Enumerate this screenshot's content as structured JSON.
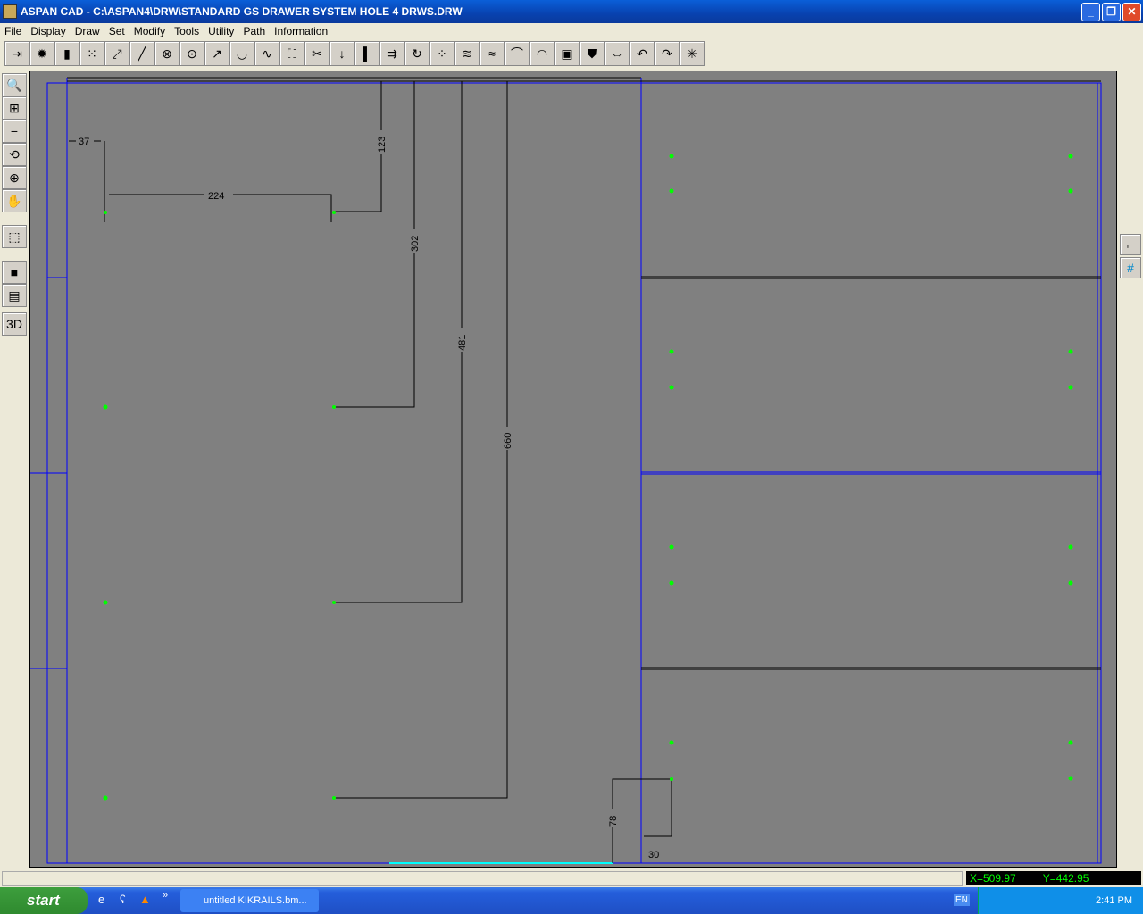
{
  "window": {
    "title": "ASPAN CAD - C:\\ASPAN4\\DRW\\STANDARD GS DRAWER SYSTEM HOLE 4 DRWS.DRW"
  },
  "menu": [
    "File",
    "Display",
    "Draw",
    "Set",
    "Modify",
    "Tools",
    "Utility",
    "Path",
    "Information"
  ],
  "toolbar_icons": [
    "exit-icon",
    "gears-icon",
    "cylinder-icon",
    "dot-grid-icon",
    "dimension-icon",
    "line-icon",
    "circle-3pt-icon",
    "circle-center-icon",
    "line-tangent-icon",
    "arc-tangent-icon",
    "curve-icon",
    "rectangle-points-icon",
    "cut-icon",
    "drill-icon",
    "tool-icon",
    "offset-icon",
    "rotate-icon",
    "pattern-icon",
    "hatch-icon",
    "hatch2-icon",
    "arc-icon",
    "rainbow-arc-icon",
    "layer-icon",
    "shield-icon",
    "stretch-icon",
    "undo-icon",
    "redo-icon",
    "explode-icon"
  ],
  "left_toolbar_icons": [
    "zoom-window-icon",
    "zoom-all-icon",
    "zoom-out-icon",
    "zoom-previous-icon",
    "zoom-center-icon",
    "pan-hand-icon",
    "view-3d-box-icon",
    "solid-box-icon",
    "view-front-icon",
    "view-3d-icon"
  ],
  "drawing": {
    "dimensions": [
      "37",
      "224",
      "123",
      "302",
      "481",
      "660",
      "78",
      "30"
    ],
    "colors": {
      "background": "#808080",
      "frame": "#0000ff",
      "point": "#00ff00"
    }
  },
  "status": {
    "x": "X=509.97",
    "y": "Y=442.95"
  },
  "taskbar": {
    "start": "start",
    "task": "untitled KIKRAILS.bm...",
    "lang": "EN",
    "clock": "2:41 PM",
    "chevron": "»"
  }
}
